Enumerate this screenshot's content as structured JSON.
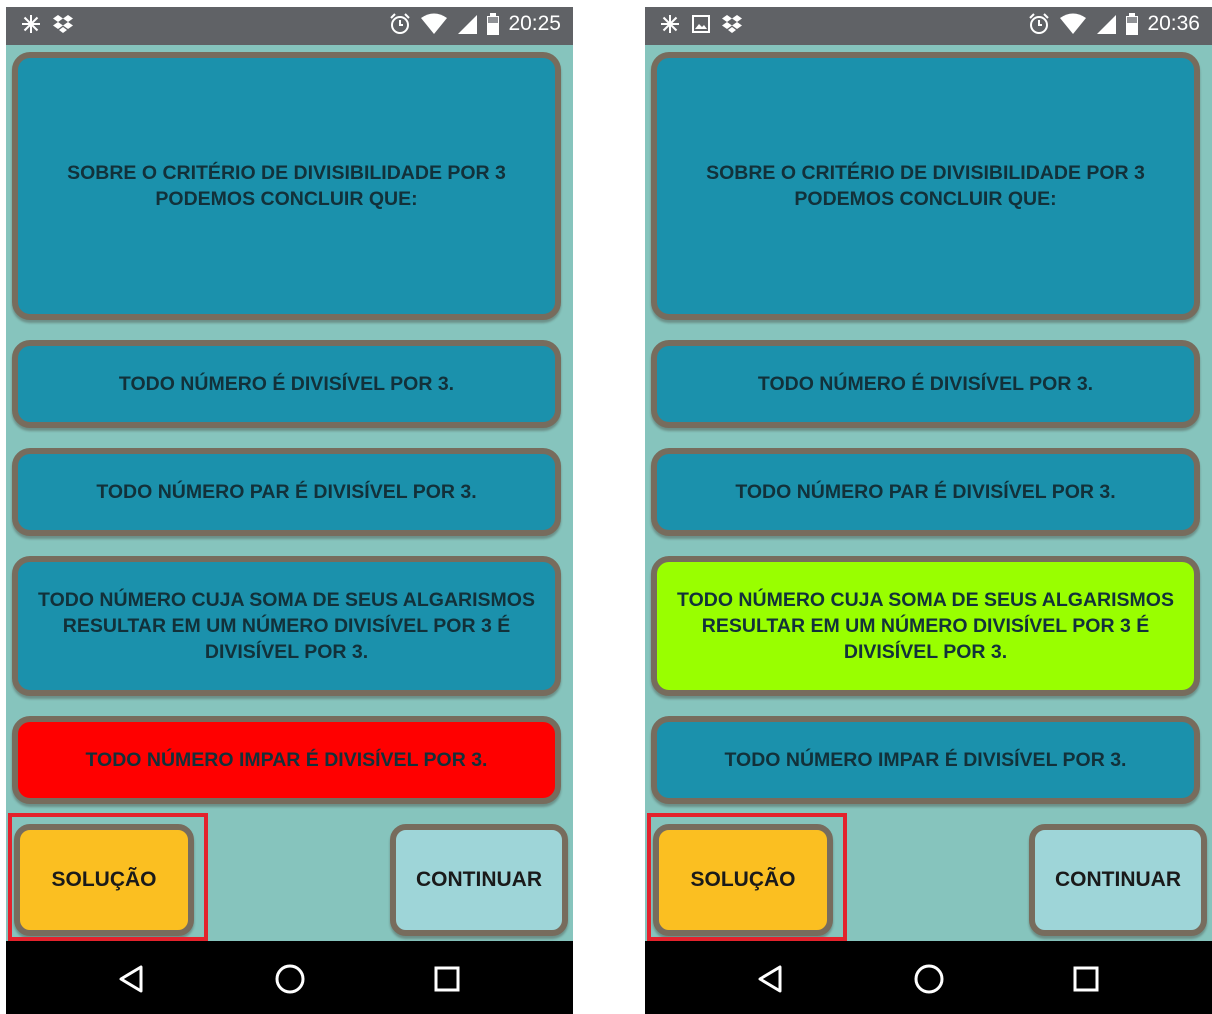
{
  "screens": [
    {
      "status_time": "20:25",
      "status_left_icons": [
        "sparkle-icon",
        "dropbox-icon"
      ],
      "status_right_icons": [
        "alarm-icon",
        "wifi-icon",
        "signal-icon",
        "battery-icon"
      ],
      "question": "SOBRE O CRITÉRIO DE DIVISIBILIDADE POR 3 PODEMOS CONCLUIR QUE:",
      "options": [
        {
          "text": "TODO NÚMERO É DIVISÍVEL POR 3.",
          "state": "default"
        },
        {
          "text": "TODO NÚMERO PAR É DIVISÍVEL POR 3.",
          "state": "default"
        },
        {
          "text": "TODO NÚMERO CUJA SOMA DE SEUS ALGARISMOS RESULTAR EM UM NÚMERO DIVISÍVEL POR 3 É DIVISÍVEL POR 3.",
          "state": "default"
        },
        {
          "text": "TODO NÚMERO IMPAR É DIVISÍVEL POR 3.",
          "state": "wrong"
        }
      ],
      "solution_label": "SOLUÇÃO",
      "continue_label": "CONTINUAR"
    },
    {
      "status_time": "20:36",
      "status_left_icons": [
        "sparkle-icon",
        "image-icon",
        "dropbox-icon"
      ],
      "status_right_icons": [
        "alarm-icon",
        "wifi-icon",
        "signal-icon",
        "battery-icon"
      ],
      "question": "SOBRE O CRITÉRIO DE DIVISIBILIDADE POR 3 PODEMOS CONCLUIR QUE:",
      "options": [
        {
          "text": "TODO NÚMERO É DIVISÍVEL POR 3.",
          "state": "default"
        },
        {
          "text": "TODO NÚMERO PAR É DIVISÍVEL POR 3.",
          "state": "default"
        },
        {
          "text": "TODO NÚMERO CUJA SOMA DE SEUS ALGARISMOS RESULTAR EM UM NÚMERO DIVISÍVEL POR 3 É DIVISÍVEL POR 3.",
          "state": "correct"
        },
        {
          "text": "TODO NÚMERO IMPAR É DIVISÍVEL POR 3.",
          "state": "default"
        }
      ],
      "solution_label": "SOLUÇÃO",
      "continue_label": "CONTINUAR"
    }
  ],
  "colors": {
    "background": "#86c4bd",
    "card": "#1b91ac",
    "card_border": "#776c5d",
    "wrong": "#ff0000",
    "correct": "#99ff00",
    "solution_button": "#fbbf21",
    "continue_button": "#9ed5d8",
    "highlight_border": "#e3222c",
    "status_bar": "#606266",
    "nav_bar": "#000000"
  },
  "nav_icons": [
    "back-icon",
    "home-icon",
    "recents-icon"
  ]
}
